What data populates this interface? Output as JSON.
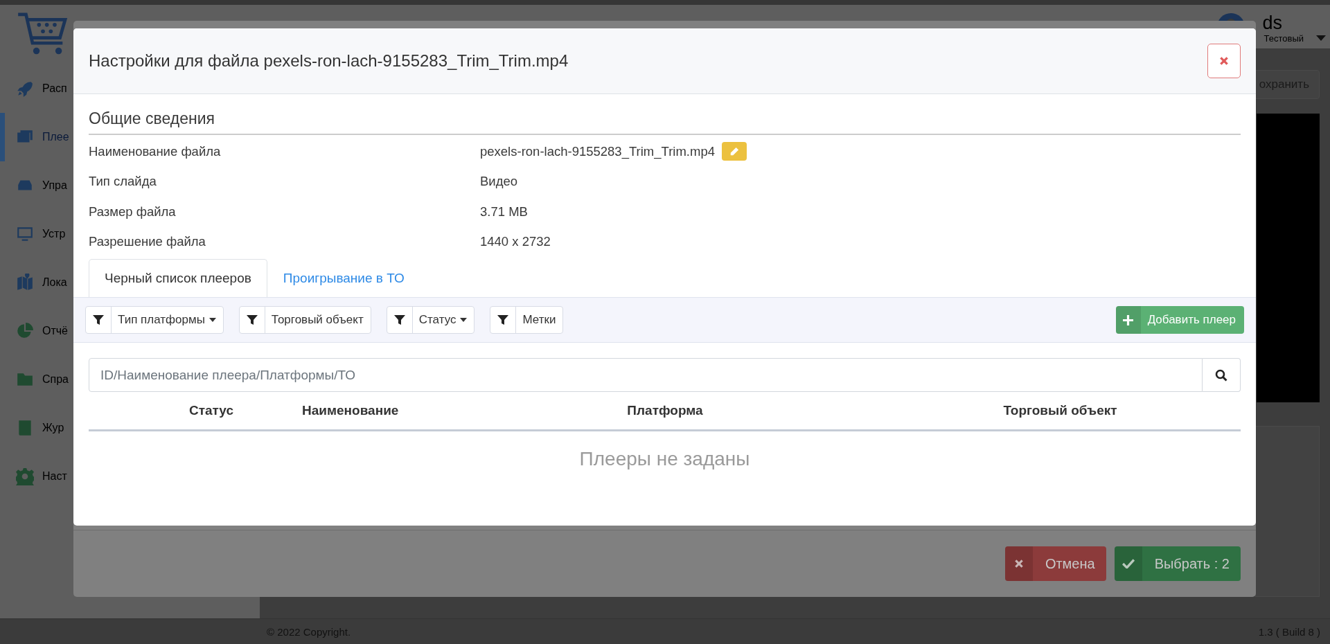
{
  "sidebar": {
    "items": [
      {
        "label": "Расп",
        "selected": false
      },
      {
        "label": "Плее",
        "selected": true
      },
      {
        "label": "Упра",
        "selected": false
      },
      {
        "label": "Устр",
        "selected": false
      },
      {
        "label": "Лока",
        "selected": false
      },
      {
        "label": "Отчё",
        "selected": false
      },
      {
        "label": "Спра",
        "selected": false
      },
      {
        "label": "Жур",
        "selected": false
      },
      {
        "label": "Наст",
        "selected": false
      }
    ]
  },
  "user": {
    "name": "ds",
    "role": "Тестовый"
  },
  "save_button": "охранить",
  "footer": {
    "copyright": "© 2022 Copyright.",
    "version": "1.3 ( Build 8 )"
  },
  "back_dialog": {
    "buttons": [
      {
        "label": "Отмена",
        "kind": "cancel"
      },
      {
        "label": "Выбрать : 2",
        "kind": "confirm"
      }
    ]
  },
  "dialog": {
    "title": "Настройки для файла pexels-ron-lach-9155283_Trim_Trim.mp4",
    "section": "Общие сведения",
    "fields": [
      {
        "label": "Наименование файла",
        "value": "pexels-ron-lach-9155283_Trim_Trim.mp4",
        "editable": true
      },
      {
        "label": "Тип слайда",
        "value": "Видео",
        "editable": false
      },
      {
        "label": "Размер файла",
        "value": "3.71 MB",
        "editable": false
      },
      {
        "label": "Разрешение файла",
        "value": "1440 x 2732",
        "editable": false
      }
    ],
    "tabs": [
      {
        "label": "Черный список плееров",
        "selected": true
      },
      {
        "label": "Проигрывание в ТО",
        "selected": false
      }
    ],
    "filters": [
      {
        "label": "Тип платформы",
        "dropdown": true
      },
      {
        "label": "Торговый объект",
        "dropdown": false
      },
      {
        "label": "Статус",
        "dropdown": true
      },
      {
        "label": "Метки",
        "dropdown": false
      }
    ],
    "add_button": "Добавить плеер",
    "search": {
      "placeholder": "ID/Наименование плеера/Платформы/ТО"
    },
    "table": {
      "columns": [
        "Статус",
        "Наименование",
        "Платформа",
        "Торговый объект"
      ],
      "empty_text": "Плееры не заданы"
    }
  }
}
